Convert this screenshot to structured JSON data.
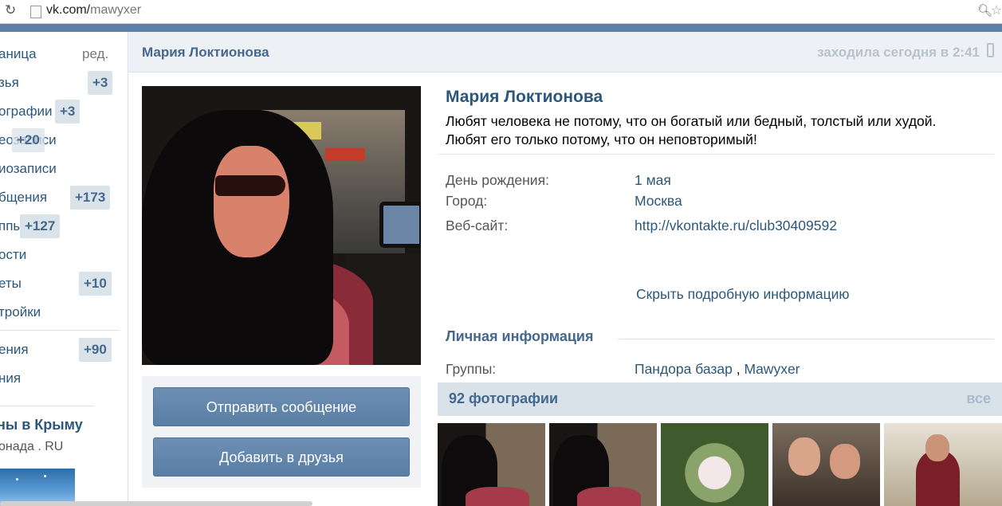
{
  "browser": {
    "url_host": "vk.com/",
    "url_path": "mawyxer"
  },
  "sidebar": {
    "items": [
      {
        "label": "аница",
        "badge": "",
        "edit": "ред."
      },
      {
        "label": "зья",
        "badge": "+3",
        "edit": ""
      },
      {
        "label": "ографии",
        "badge": "+3",
        "edit": ""
      },
      {
        "label": "еозаписи",
        "badge": "+20",
        "edit": ""
      },
      {
        "label": "иозаписи",
        "badge": "",
        "edit": ""
      },
      {
        "label": "бщения",
        "badge": "+173",
        "edit": ""
      },
      {
        "label": "ппы",
        "badge": "+127",
        "edit": ""
      },
      {
        "label": "ости",
        "badge": "",
        "edit": ""
      },
      {
        "label": "еты",
        "badge": "+10",
        "edit": ""
      },
      {
        "label": "тройки",
        "badge": "",
        "edit": ""
      },
      {
        "label": "ения",
        "badge": "+90",
        "edit": ""
      },
      {
        "label": "ния",
        "badge": "",
        "edit": ""
      }
    ],
    "ad": {
      "title": "ны в Крыму",
      "domain": "онада . RU"
    }
  },
  "header": {
    "name": "Мария Локтионова",
    "last_seen": "заходила сегодня в 2:41"
  },
  "profile": {
    "name": "Мария Локтионова",
    "status": "Любят человека не потому, что он богатый или бедный, толстый или худой. Любят его только потому, что он неповторимый!",
    "fields": [
      {
        "key": "День рождения:",
        "value": "1 мая"
      },
      {
        "key": "Город:",
        "value": "Москва"
      },
      {
        "key": "Веб-сайт:",
        "value": "http://vkontakte.ru/club30409592"
      }
    ],
    "hide_details": "Скрыть подробную информацию",
    "personal_section": "Личная информация",
    "groups_key": "Группы:",
    "groups": [
      "Пандора базар",
      "Mawyxer"
    ],
    "groups_sep": " , "
  },
  "actions": {
    "send_message": "Отправить сообщение",
    "add_friend": "Добавить в друзья"
  },
  "photos": {
    "title": "92 фотографии",
    "all": "все"
  }
}
